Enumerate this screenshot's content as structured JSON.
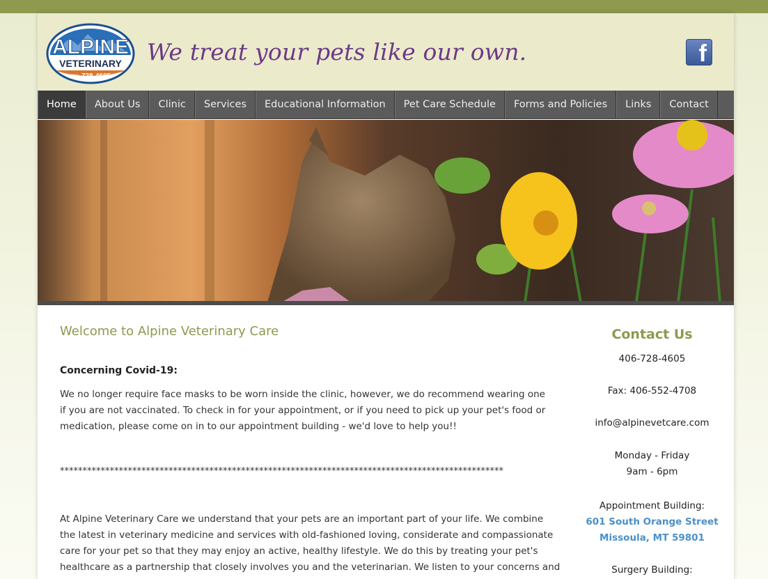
{
  "colors": {
    "top_strip": "#8f9a4e",
    "header_bg": "#ebeacb",
    "tagline": "#6c3a86",
    "nav_bg": "#5b5b5b",
    "nav_active": "#3b3b3b",
    "heading_green": "#8c9a4f",
    "link_blue": "#4a90c9"
  },
  "header": {
    "logo": {
      "brand_top": "ALPINE",
      "brand_bottom": "VETERINARY",
      "phone_prefix": "(406)",
      "phone": "728-4605"
    },
    "tagline": "We treat your pets like our own.",
    "facebook_icon": "facebook-icon"
  },
  "nav": {
    "items": [
      {
        "label": "Home",
        "active": true
      },
      {
        "label": "About Us"
      },
      {
        "label": "Clinic"
      },
      {
        "label": "Services"
      },
      {
        "label": "Educational Information"
      },
      {
        "label": "Pet Care Schedule"
      },
      {
        "label": "Forms and Policies"
      },
      {
        "label": "Links"
      },
      {
        "label": "Contact"
      }
    ]
  },
  "main": {
    "title": "Welcome to Alpine Veterinary Care",
    "covid_heading": "Concerning Covid-19:",
    "covid_text": "We no longer require face masks to be worn inside the clinic, however, we do recommend wearing one if you are not vaccinated. To check in for your appointment, or if you need to pick up your pet's food or medication, please come on in to our appointment building - we'd love to help you!!",
    "separator": "**************************************************************************************************",
    "intro_text": "At Alpine Veterinary Care we understand that your pets are an important part of your life. We combine the latest in veterinary medicine and services with old-fashioned loving, considerate and compassionate care for your pet so that they may enjoy an active, healthy lifestyle. We do this by treating your pet's healthcare as a partnership that closely involves you and the veterinarian. We listen to your concerns and questions, give you more than you"
  },
  "sidebar": {
    "heading": "Contact Us",
    "phone": "406-728-4605",
    "fax": "Fax: 406-552-4708",
    "email": "info@alpinevetcare.com",
    "hours_days": "Monday - Friday",
    "hours_time": "9am - 6pm",
    "appt_label": "Appointment Building:",
    "appt_street": "601 South Orange Street",
    "appt_city": "Missoula, MT 59801",
    "surgery_label": "Surgery Building:"
  }
}
